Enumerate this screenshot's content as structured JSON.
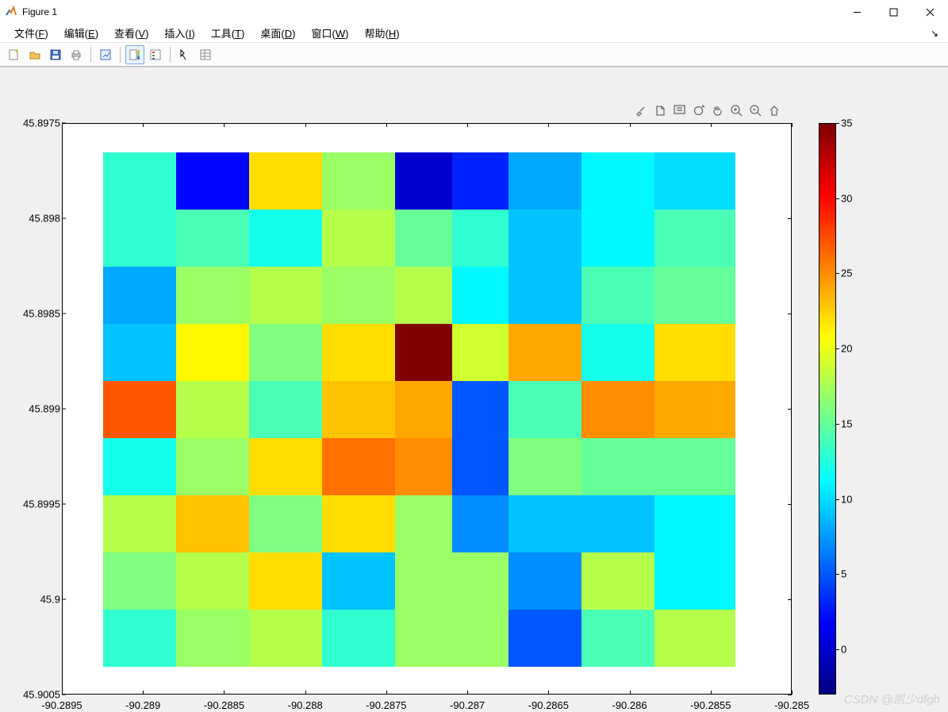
{
  "window": {
    "title": "Figure 1"
  },
  "menu": {
    "file": {
      "label": "文件",
      "key": "F"
    },
    "edit": {
      "label": "编辑",
      "key": "E"
    },
    "view": {
      "label": "查看",
      "key": "V"
    },
    "insert": {
      "label": "插入",
      "key": "I"
    },
    "tools": {
      "label": "工具",
      "key": "T"
    },
    "desktop": {
      "label": "桌面",
      "key": "D"
    },
    "window": {
      "label": "窗口",
      "key": "W"
    },
    "help": {
      "label": "帮助",
      "key": "H"
    }
  },
  "watermark": "CSDN @凯少dfgh",
  "chart_data": {
    "type": "heatmap",
    "xlabel": "",
    "ylabel": "",
    "xlim": [
      -90.2895,
      -90.285
    ],
    "ylim_reversed": true,
    "ylim": [
      45.8975,
      45.9005
    ],
    "x_ticks": [
      "-90.2895",
      "-90.289",
      "-90.2885",
      "-90.288",
      "-90.2875",
      "-90.287",
      "-90.2865",
      "-90.286",
      "-90.2855",
      "-90.285"
    ],
    "y_ticks": [
      "45.8975",
      "45.898",
      "45.8985",
      "45.899",
      "45.8995",
      "45.9",
      "45.9005"
    ],
    "colorbar": {
      "min": -3,
      "max": 35,
      "ticks": [
        0,
        5,
        10,
        15,
        20,
        25,
        30,
        35
      ]
    },
    "grid_x_centers": [
      -90.289,
      -90.28855,
      -90.2881,
      -90.28765,
      -90.2872,
      -90.28685,
      -90.2865,
      -90.28605,
      -90.2856
    ],
    "grid_y_centers": [
      45.8978,
      45.8981,
      45.8984,
      45.8987,
      45.899,
      45.8993,
      45.8996,
      45.8999,
      45.9002
    ],
    "cell_w": 0.0005,
    "cell_h": 0.0003,
    "values": [
      [
        13,
        2,
        22,
        17,
        0,
        3,
        8,
        11,
        10
      ],
      [
        13,
        14,
        12,
        18,
        15,
        13,
        9,
        11,
        14
      ],
      [
        8,
        17,
        18,
        17,
        18,
        11,
        9,
        14,
        15
      ],
      [
        9,
        21,
        16,
        22,
        35,
        19,
        24,
        12,
        22
      ],
      [
        27,
        18,
        14,
        23,
        24,
        5,
        14,
        25,
        24
      ],
      [
        12,
        17,
        22,
        26,
        25,
        5,
        16,
        15,
        15
      ],
      [
        18,
        23,
        16,
        22,
        17,
        7,
        9,
        9,
        11
      ],
      [
        16,
        18,
        22,
        9,
        17,
        17,
        7,
        18,
        11
      ],
      [
        13,
        17,
        18,
        13,
        17,
        17,
        5,
        14,
        18
      ]
    ]
  }
}
